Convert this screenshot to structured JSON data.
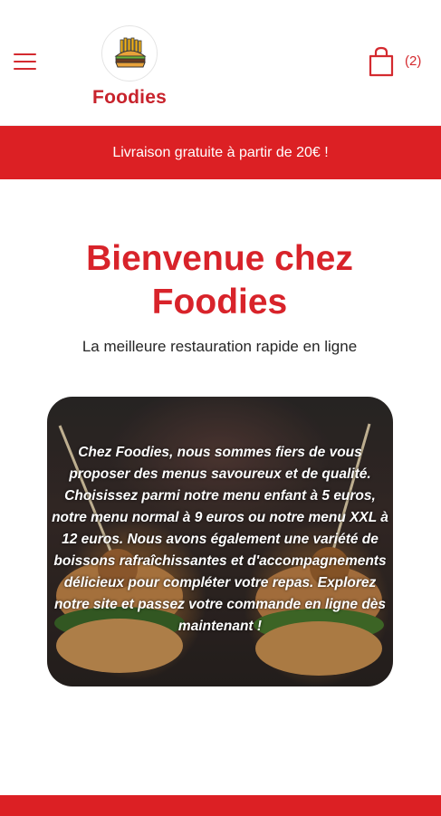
{
  "header": {
    "brand": "Foodies",
    "cart_count": "(2)"
  },
  "promo": {
    "text": "Livraison gratuite à partir de 20€ !"
  },
  "main": {
    "title": "Bienvenue chez Foodies",
    "subtitle": "La meilleure restauration rapide en ligne",
    "hero_text": "Chez Foodies, nous sommes fiers de vous proposer des menus savoureux et de qualité. Choisissez parmi notre menu enfant à 5 euros, notre menu normal à 9 euros ou notre menu XXL à 12 euros. Nous avons également une variété de boissons rafraîchissantes et d'accompagnements délicieux pour compléter votre repas. Explorez notre site et passez votre commande en ligne dès maintenant !"
  },
  "colors": {
    "brand_red": "#dc2024",
    "title_red": "#d8232a"
  },
  "icons": {
    "menu": "hamburger-menu-icon",
    "cart": "shopping-bag-icon",
    "logo": "burger-fries-logo-icon"
  }
}
